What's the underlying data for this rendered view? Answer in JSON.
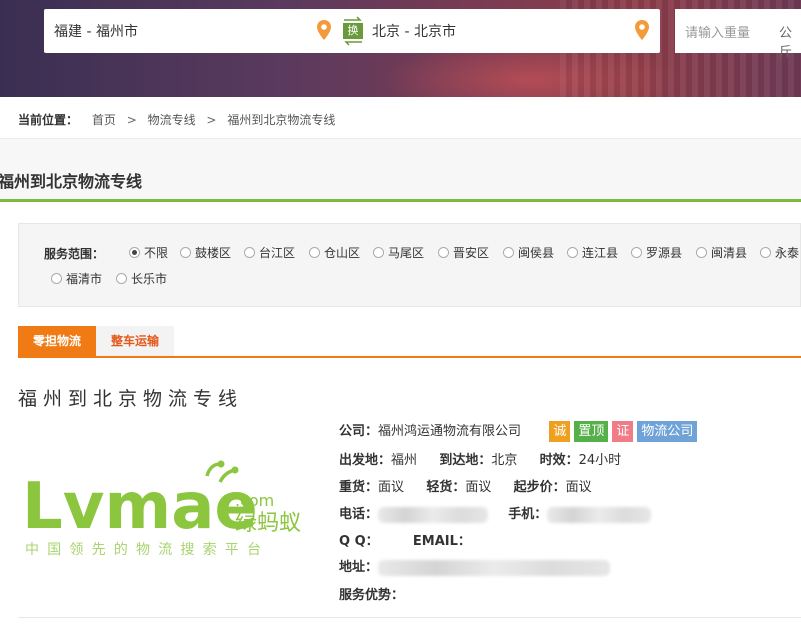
{
  "search": {
    "from": "福建 - 福州市",
    "to": "北京 - 北京市",
    "swap_label": "换",
    "weight_placeholder": "请输入重量",
    "weight_unit": "公斤"
  },
  "breadcrumb": {
    "label": "当前位置：",
    "items": [
      "首页",
      "物流专线",
      "福州到北京物流专线"
    ],
    "sep": ">"
  },
  "page_title": "福州到北京物流专线",
  "filter": {
    "label": "服务范围：",
    "options": [
      {
        "label": "不限",
        "selected": true
      },
      {
        "label": "鼓楼区",
        "selected": false
      },
      {
        "label": "台江区",
        "selected": false
      },
      {
        "label": "仓山区",
        "selected": false
      },
      {
        "label": "马尾区",
        "selected": false
      },
      {
        "label": "晋安区",
        "selected": false
      },
      {
        "label": "闽侯县",
        "selected": false
      },
      {
        "label": "连江县",
        "selected": false
      },
      {
        "label": "罗源县",
        "selected": false
      },
      {
        "label": "闽清县",
        "selected": false
      },
      {
        "label": "永泰",
        "selected": false
      },
      {
        "label": "福清市",
        "selected": false
      },
      {
        "label": "长乐市",
        "selected": false
      }
    ]
  },
  "tabs": [
    {
      "label": "零担物流",
      "active": true
    },
    {
      "label": "整车运输",
      "active": false
    }
  ],
  "detail": {
    "title": "福州到北京物流专线",
    "company_label": "公司：",
    "company": "福州鸿运通物流有限公司",
    "badges": [
      {
        "label": "诚",
        "color": "#f0a020"
      },
      {
        "label": "置顶",
        "color": "#55b04a"
      },
      {
        "label": "证",
        "color": "#ef7c86"
      },
      {
        "label": "物流公司",
        "color": "#6fa3d8"
      }
    ],
    "origin_label": "出发地：",
    "origin": "福州",
    "dest_label": "到达地：",
    "dest": "北京",
    "time_label": "时效：",
    "time": "24小时",
    "heavy_label": "重货：",
    "heavy": "面议",
    "light_label": "轻货：",
    "light": "面议",
    "min_label": "起步价：",
    "min": "面议",
    "phone_label": "电话：",
    "mobile_label": "手机：",
    "qq_label": "Q Q：",
    "email_label": "EMAIL：",
    "address_label": "地址：",
    "advantage_label": "服务优势："
  },
  "logo": {
    "text": "Lvmae",
    "com": ".com",
    "cn_name": "绿蚂蚁",
    "slogan": "中国领先的物流搜索平台"
  },
  "colors": {
    "accent_orange": "#f07a14",
    "accent_green": "#7dba3c",
    "logo_green": "#8cc63f",
    "pin_orange": "#f39a3a"
  }
}
